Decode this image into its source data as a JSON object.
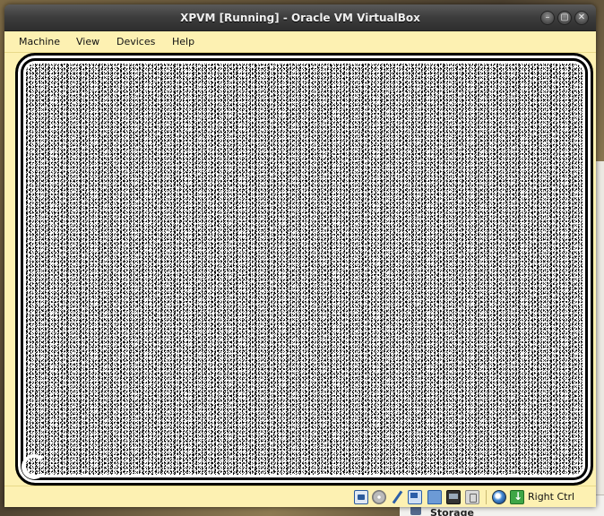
{
  "window": {
    "title": "XPVM [Running] - Oracle VM VirtualBox",
    "controls": {
      "minimize": "–",
      "maximize": "▢",
      "close": "✕"
    }
  },
  "menubar": {
    "items": [
      "Machine",
      "View",
      "Devices",
      "Help"
    ]
  },
  "statusbar": {
    "icons": [
      "hard-disk-icon",
      "optical-drive-icon",
      "usb-icon",
      "network-icon",
      "shared-folders-icon",
      "display-icon",
      "recording-icon",
      "mouse-integration-icon",
      "keyboard-capture-icon"
    ],
    "host_key": "Right Ctrl"
  },
  "background": {
    "storage_label": "Storage"
  },
  "colors": {
    "menubar_bg": "#fdf1b2",
    "titlebar_bg": "#3c3c3c",
    "vm_screen_bg": "#000000"
  }
}
